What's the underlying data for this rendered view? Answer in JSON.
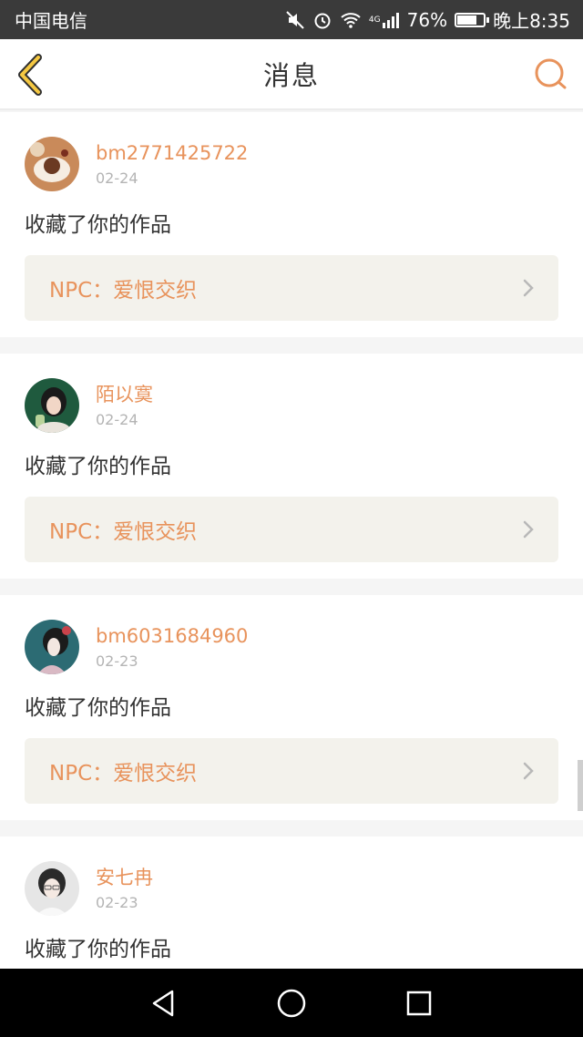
{
  "status_bar": {
    "carrier": "中国电信",
    "network": "4G",
    "battery_percent": "76%",
    "battery_level": 0.76,
    "time": "晚上8:35",
    "icons": [
      "mute-icon",
      "alarm-icon",
      "wifi-icon",
      "signal-icon",
      "battery-icon"
    ]
  },
  "header": {
    "title": "消息",
    "back_icon": "chevron-left-icon",
    "search_icon": "search-icon",
    "accent_color": "#e8935c"
  },
  "messages": [
    {
      "username": "bm2771425722",
      "date": "02-24",
      "action": "收藏了你的作品",
      "work": "NPC：爱恨交织"
    },
    {
      "username": "陌以寞",
      "date": "02-24",
      "action": "收藏了你的作品",
      "work": "NPC：爱恨交织"
    },
    {
      "username": "bm6031684960",
      "date": "02-23",
      "action": "收藏了你的作品",
      "work": "NPC：爱恨交织"
    },
    {
      "username": "安七冉",
      "date": "02-23",
      "action": "收藏了你的作品"
    }
  ],
  "system_nav": {
    "back": "back-triangle-icon",
    "home": "home-circle-icon",
    "recents": "recents-square-icon"
  }
}
